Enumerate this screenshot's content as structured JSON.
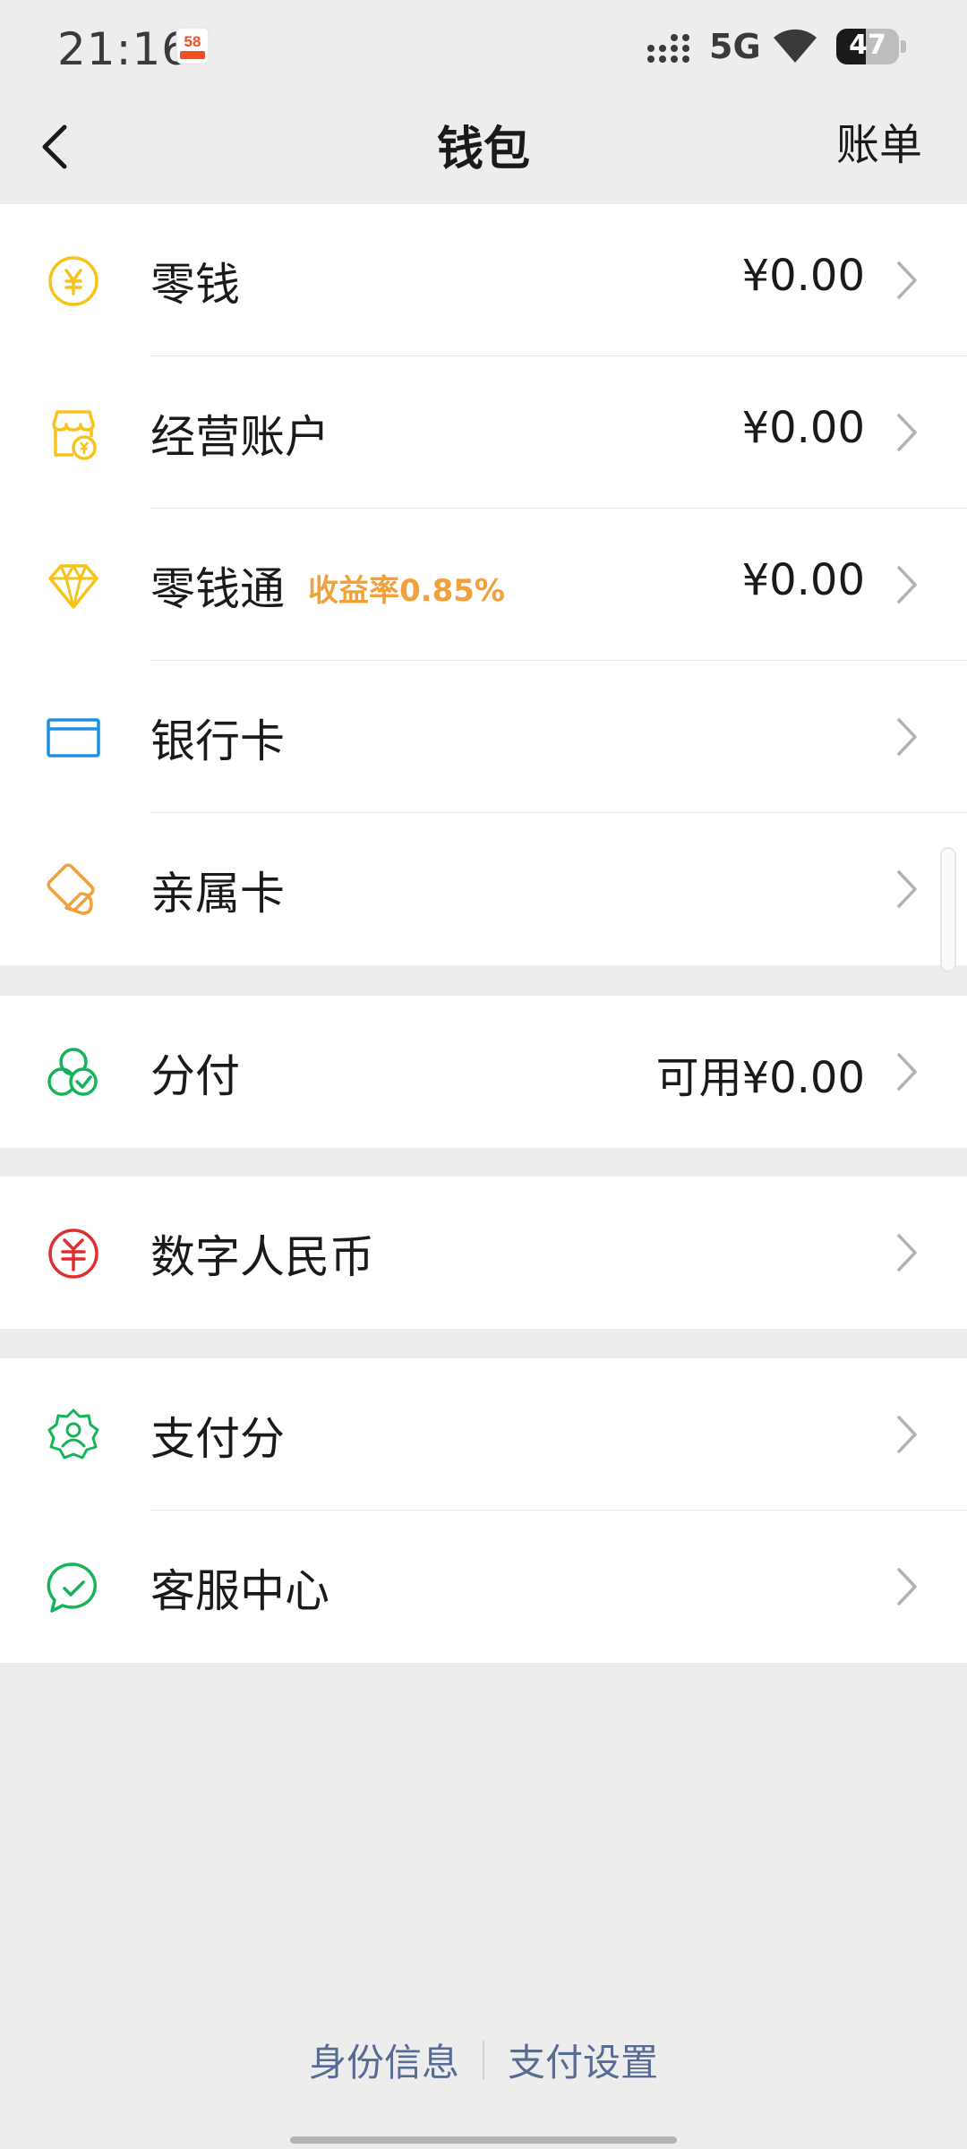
{
  "status_bar": {
    "time": "21:16",
    "badge": "58",
    "network": "5G",
    "battery": "47",
    "battery_level": 0.47
  },
  "header": {
    "title": "钱包",
    "right_label": "账单"
  },
  "groups": [
    {
      "items": [
        {
          "label": "零钱",
          "value": "¥0.00",
          "icon": "yuan-coin-icon",
          "color": "#f6c31b"
        },
        {
          "label": "经营账户",
          "value": "¥0.00",
          "icon": "shop-account-icon",
          "color": "#f6c31b"
        },
        {
          "label": "零钱通",
          "tag": "收益率0.85%",
          "value": "¥0.00",
          "icon": "diamond-icon",
          "color": "#f6c31b"
        },
        {
          "label": "银行卡",
          "value": "",
          "icon": "bank-card-icon",
          "color": "#1d8fe0"
        },
        {
          "label": "亲属卡",
          "value": "",
          "icon": "family-card-icon",
          "color": "#f0a13b"
        }
      ]
    },
    {
      "items": [
        {
          "label": "分付",
          "value": "可用¥0.00",
          "icon": "fenfu-icon",
          "color": "#15b35a"
        }
      ]
    },
    {
      "items": [
        {
          "label": "数字人民币",
          "value": "",
          "icon": "digital-rmb-icon",
          "color": "#e02e2e"
        }
      ]
    },
    {
      "items": [
        {
          "label": "支付分",
          "value": "",
          "icon": "pay-score-icon",
          "color": "#15b35a"
        },
        {
          "label": "客服中心",
          "value": "",
          "icon": "customer-service-icon",
          "color": "#15b35a"
        }
      ]
    }
  ],
  "footer": {
    "identity_info": "身份信息",
    "payment_settings": "支付设置"
  },
  "colors": {
    "background": "#ededed",
    "link": "#576b95",
    "tag": "#f0a13b"
  }
}
